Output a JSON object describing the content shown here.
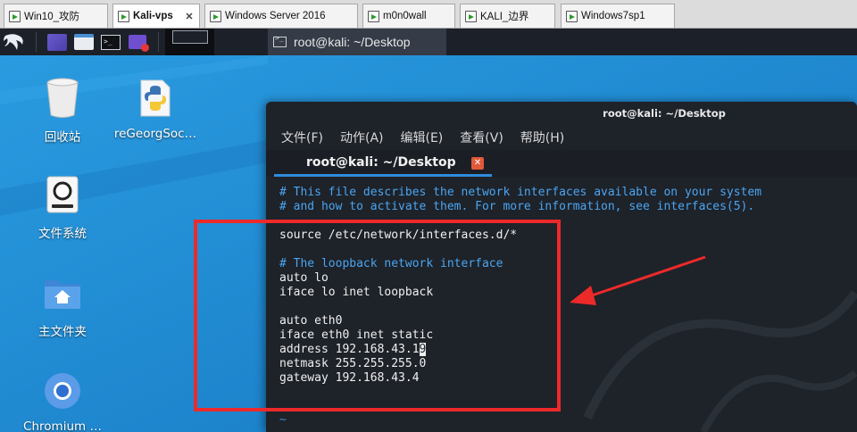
{
  "vm_tabs": [
    {
      "label": "Win10_攻防",
      "active": false
    },
    {
      "label": "Kali-vps",
      "active": true
    },
    {
      "label": "Windows Server 2016",
      "active": false
    },
    {
      "label": "m0n0wall",
      "active": false
    },
    {
      "label": "KALI_边界",
      "active": false
    },
    {
      "label": "Windows7sp1",
      "active": false
    }
  ],
  "taskbar": {
    "active_window_label": "root@kali: ~/Desktop"
  },
  "desktop_icons": [
    {
      "label": "回收站",
      "icon": "trash-icon"
    },
    {
      "label": "reGeorgSoc…",
      "icon": "python-file-icon"
    },
    {
      "label": "文件系统",
      "icon": "drive-icon"
    },
    {
      "label": "主文件夹",
      "icon": "home-folder-icon"
    },
    {
      "label": "Chromium …",
      "icon": "chromium-icon"
    }
  ],
  "terminal": {
    "title": "root@kali: ~/Desktop",
    "menu": [
      "文件(F)",
      "动作(A)",
      "编辑(E)",
      "查看(V)",
      "帮助(H)"
    ],
    "tab_label": "root@kali: ~/Desktop",
    "lines": [
      "# This file describes the network interfaces available on your system",
      "# and how to activate them. For more information, see interfaces(5).",
      "",
      "source /etc/network/interfaces.d/*",
      "",
      "# The loopback network interface",
      "auto lo",
      "iface lo inet loopback",
      "",
      "auto eth0",
      "iface eth0 inet static",
      "address 192.168.43.19",
      "netmask 255.255.255.0",
      "gateway 192.168.43.4",
      "",
      "~"
    ],
    "address_prefix": "address 192.168.43.1",
    "address_cursor_char": "9"
  },
  "colors": {
    "desktop_bg": "#1f8fd6",
    "panel_bg": "#1c2129",
    "terminal_bg": "#1e2229",
    "comment": "#4aa5f0",
    "tab_underline": "#2f8bdc",
    "annotation": "#ec2a2a"
  }
}
